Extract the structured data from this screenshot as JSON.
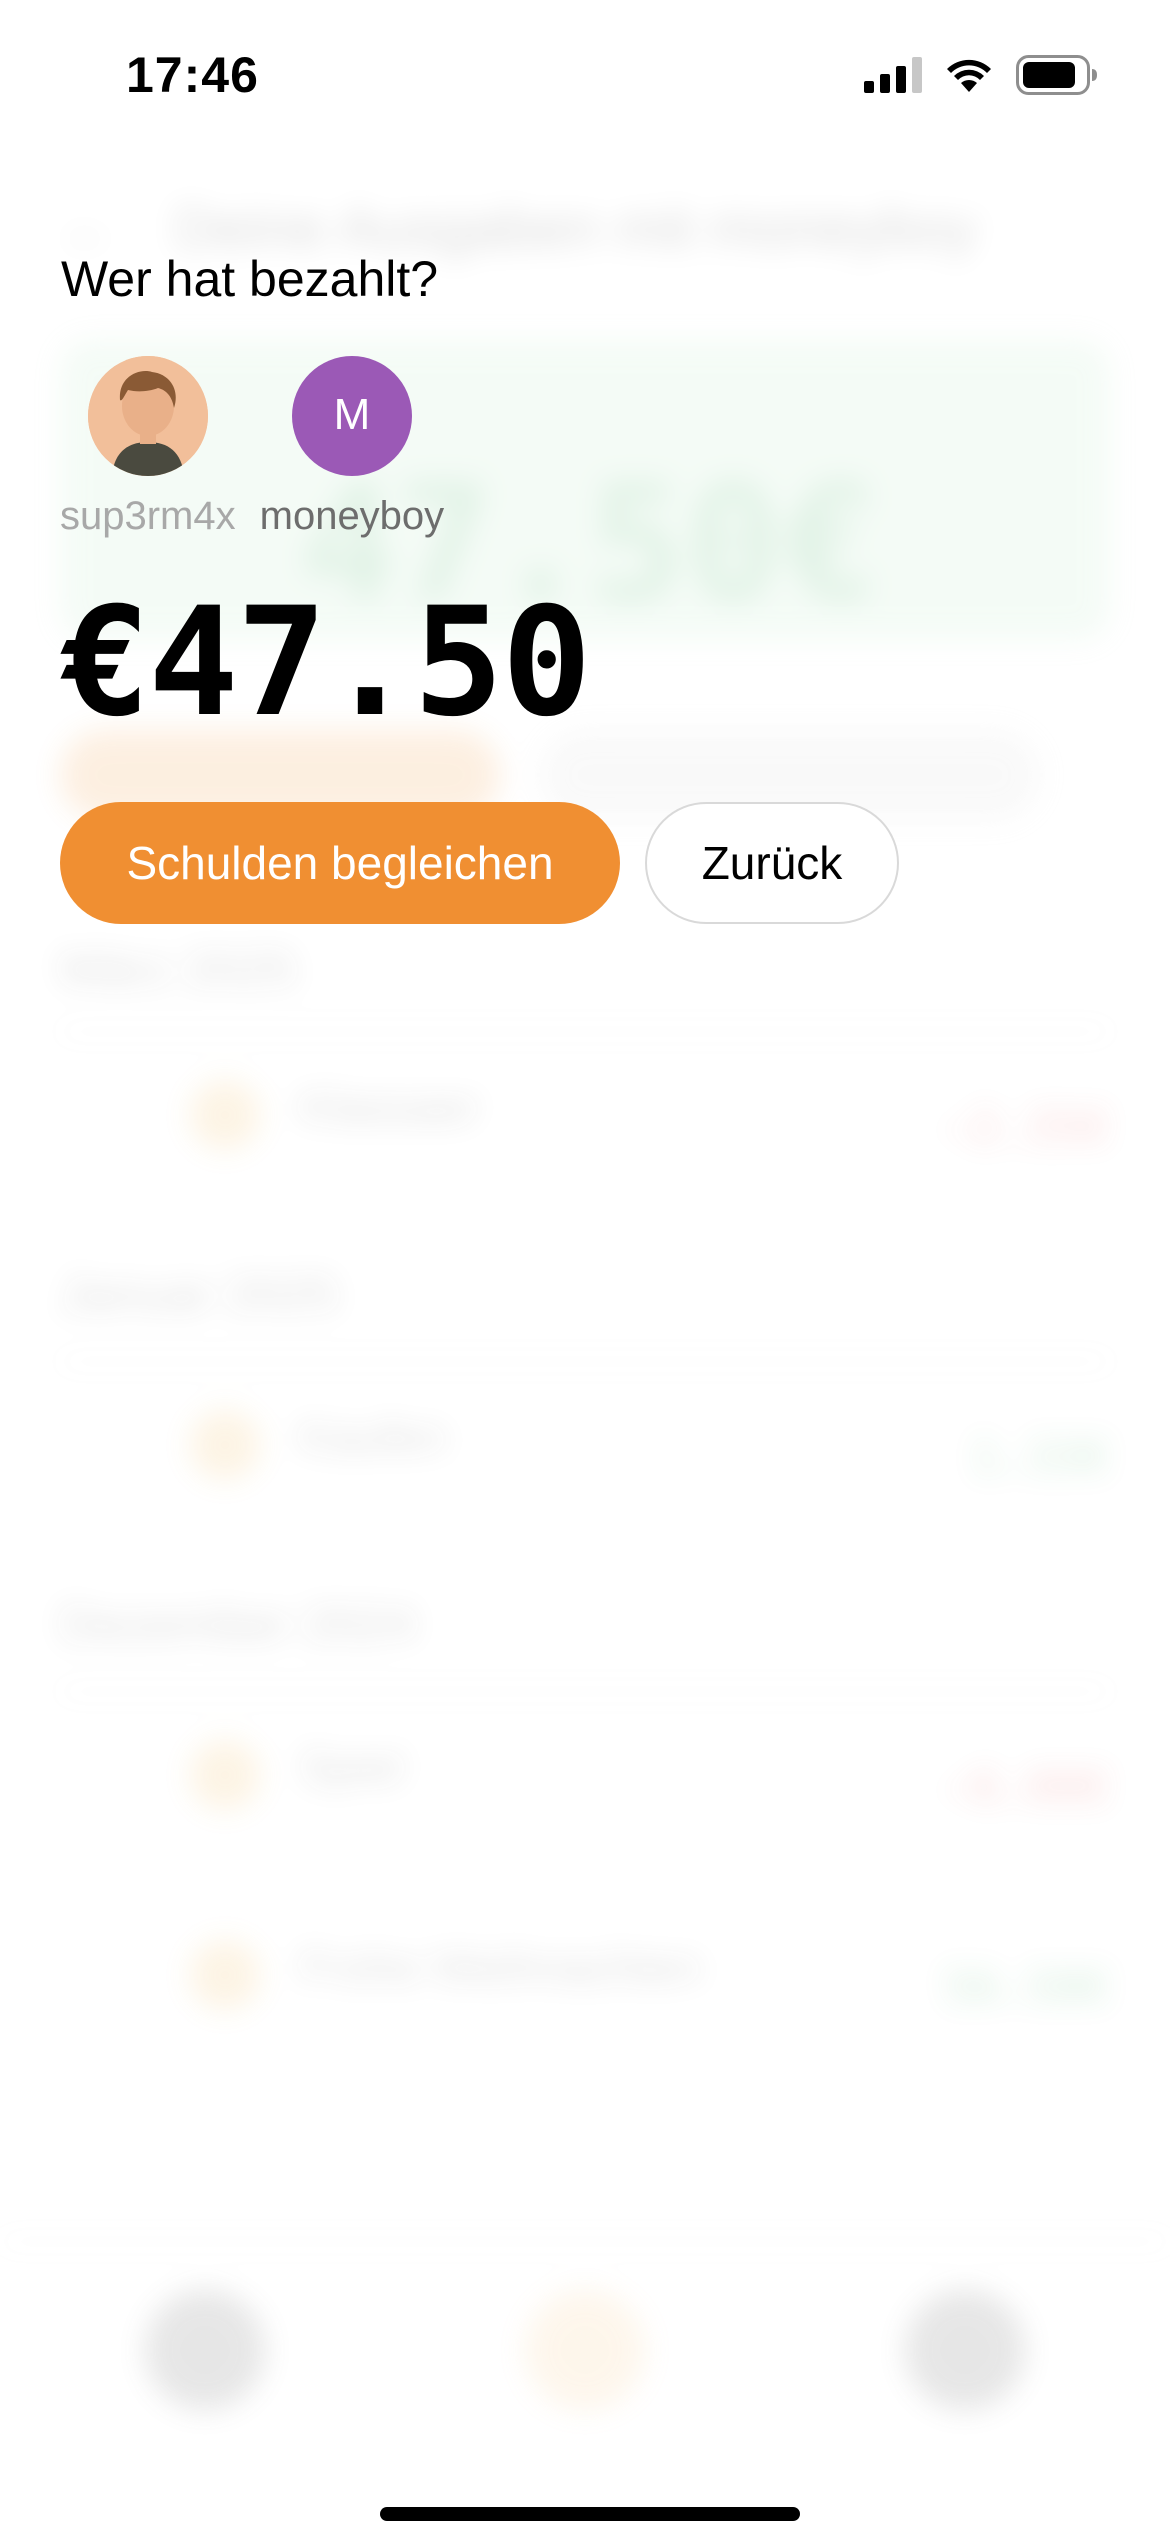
{
  "status_bar": {
    "time": "17:46"
  },
  "background": {
    "header_title": "Deine Ausgaben mit moneyboy",
    "card_amount": "47.50€",
    "months": [
      {
        "label": "März 2025",
        "rows": [
          {
            "title": "Klassaer",
            "amount": "-2.35€"
          }
        ]
      },
      {
        "label": "Januar 2025",
        "rows": [
          {
            "title": "Kaufen",
            "amount": "1.33€"
          }
        ]
      },
      {
        "label": "Dezember 2024",
        "rows": [
          {
            "title": "Spiel",
            "amount": "-6.00€"
          },
          {
            "title": "Frohe Weihnachten",
            "amount": "56.50€"
          }
        ]
      }
    ]
  },
  "modal": {
    "title": "Wer hat bezahlt?",
    "payers": [
      {
        "name": "sup3rm4x",
        "avatar": "photo",
        "selected": false
      },
      {
        "name": "moneyboy",
        "initial": "M",
        "avatar": "letter",
        "selected": true
      }
    ],
    "amount": "€47.50",
    "primary_button": "Schulden begleichen",
    "secondary_button": "Zurück"
  },
  "colors": {
    "accent": "#f08f32",
    "avatar_purple": "#9b59b6",
    "positive": "#2fa852",
    "negative": "#e34545"
  },
  "icons": {
    "signal": "cellular-signal-icon",
    "wifi": "wifi-icon",
    "battery": "battery-icon"
  }
}
